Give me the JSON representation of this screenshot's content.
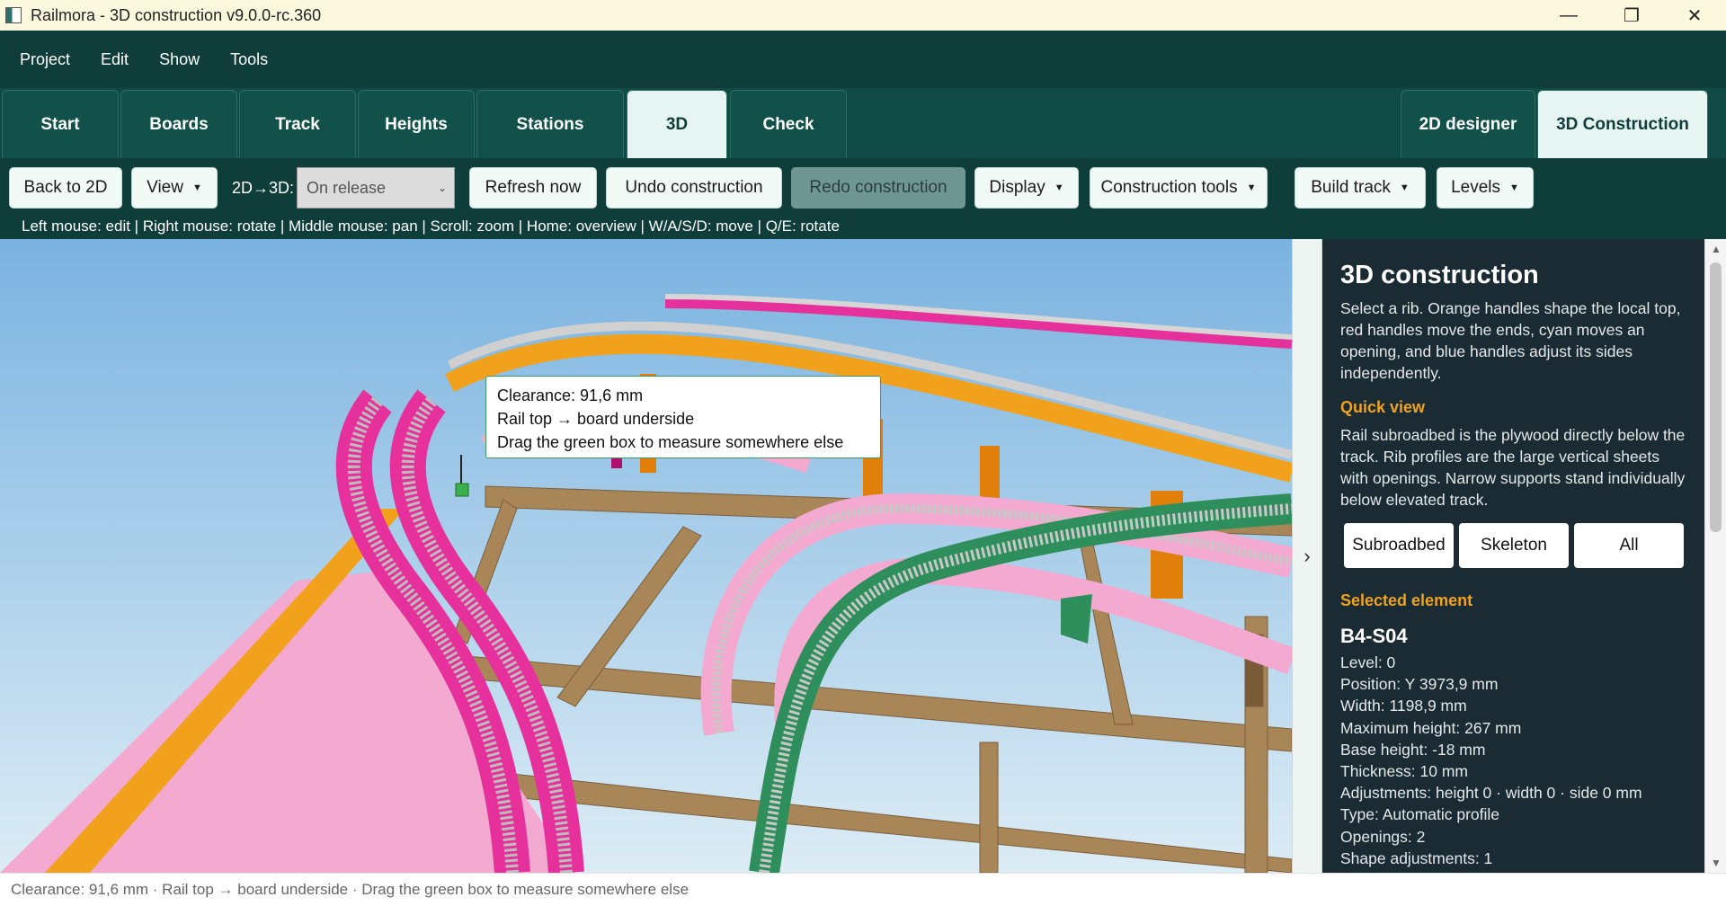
{
  "window": {
    "title": "Railmora - 3D construction v9.0.0-rc.360",
    "app_icon": "app-window-icon",
    "controls": {
      "minimize": "—",
      "maximize": "❐",
      "close": "✕"
    }
  },
  "menu": [
    "Project",
    "Edit",
    "Show",
    "Tools"
  ],
  "tabs": {
    "main": [
      {
        "label": "Start",
        "active": false
      },
      {
        "label": "Boards",
        "active": false
      },
      {
        "label": "Track",
        "active": false
      },
      {
        "label": "Heights",
        "active": false
      },
      {
        "label": "Stations",
        "active": false
      },
      {
        "label": "3D",
        "active": true
      },
      {
        "label": "Check",
        "active": false
      }
    ],
    "mode": [
      {
        "label": "2D designer",
        "active": false
      },
      {
        "label": "3D Construction",
        "active": true
      }
    ]
  },
  "toolbar": {
    "back_to_2d": "Back to 2D",
    "view": "View",
    "label_2d3d": "2D→3D:",
    "select_value": "On release",
    "refresh": "Refresh now",
    "undo": "Undo construction",
    "redo": "Redo construction",
    "display": "Display",
    "construction_tools": "Construction tools",
    "build_track": "Build track",
    "levels": "Levels",
    "caret": "▼",
    "hint": "Left mouse: edit | Right mouse: rotate | Middle mouse: pan | Scroll: zoom | Home: overview | W/A/S/D: move | Q/E: rotate"
  },
  "tooltip": {
    "line1": "Clearance: 91,6 mm",
    "line2": "Rail top → board underside",
    "line3": "Drag the green box to measure somewhere else"
  },
  "colors": {
    "sky_top": "#7ab3e0",
    "sky_bottom": "#dcecf5",
    "wood": "#a98658",
    "pink": "#e6309b",
    "light_pink": "#f3a9d0",
    "orange": "#f2a11c",
    "green": "#2e8f5c",
    "accent": "#f0a21e"
  },
  "collapse_icon": "chevron-right-icon",
  "panel": {
    "title": "3D construction",
    "intro": "Select a rib. Orange handles shape the local top, red handles move the ends, cyan moves an opening, and blue handles adjust its sides independently.",
    "quick_view_title": "Quick view",
    "quick_view_text": "Rail subroadbed is the plywood directly below the track. Rib profiles are the large vertical sheets with openings. Narrow supports stand individually below elevated track.",
    "view_buttons": [
      "Subroadbed",
      "Skeleton",
      "All"
    ],
    "selected_title": "Selected element",
    "element_name": "B4-S04",
    "properties": [
      "Level: 0",
      "Position: Y 3973,9 mm",
      "Width: 1198,9 mm",
      "Maximum height: 267 mm",
      "Base height: -18 mm",
      "Thickness: 10 mm",
      "Adjustments: height 0 · width 0 · side 0 mm",
      "Type: Automatic profile",
      "Openings: 2",
      "Shape adjustments: 1"
    ]
  },
  "scrollbar": {
    "up": "▲",
    "down": "▼"
  },
  "status": "Clearance: 91,6 mm · Rail top → board underside · Drag the green box to measure somewhere else"
}
